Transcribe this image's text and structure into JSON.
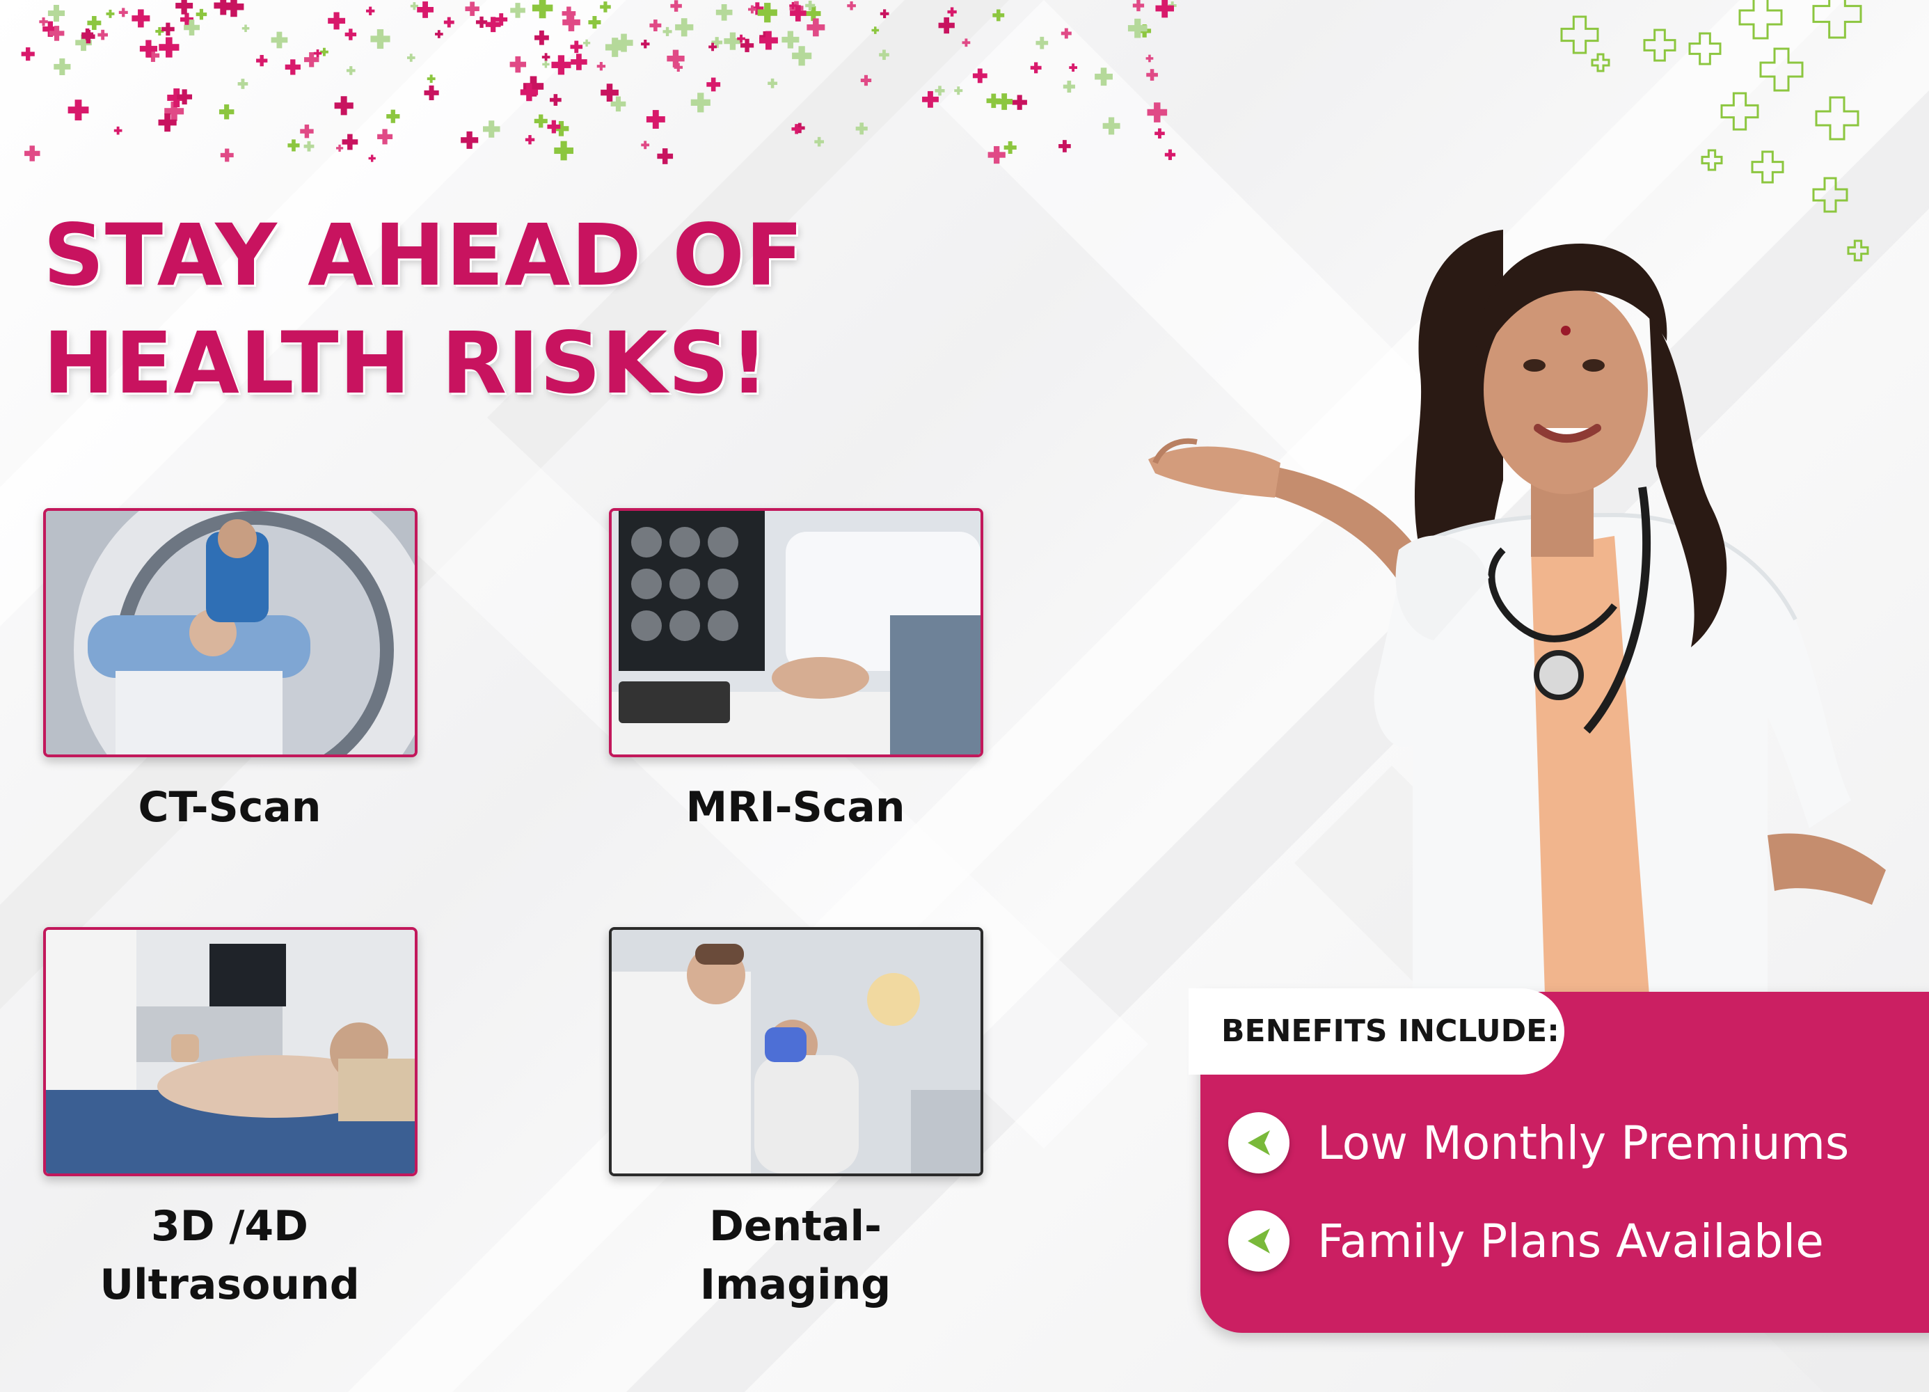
{
  "headline": {
    "line1": "STAY AHEAD OF",
    "line2": "HEALTH RISKS!"
  },
  "services": [
    {
      "label": "CT-Scan"
    },
    {
      "label": "MRI-Scan"
    },
    {
      "label": "3D /4D",
      "label2": "Ultrasound"
    },
    {
      "label": "Dental-",
      "label2": "Imaging"
    }
  ],
  "benefits": {
    "title": "BENEFITS INCLUDE:",
    "items": [
      {
        "text": "Low Monthly Premiums"
      },
      {
        "text": "Family Plans Available"
      }
    ]
  },
  "colors": {
    "brand": "#c8135f",
    "panel": "#cb1f62",
    "accent_green": "#7ac943",
    "text_dark": "#111111"
  },
  "icons": [
    "plus-confetti-icon",
    "green-cross-icon",
    "triangle-bullet-icon"
  ]
}
